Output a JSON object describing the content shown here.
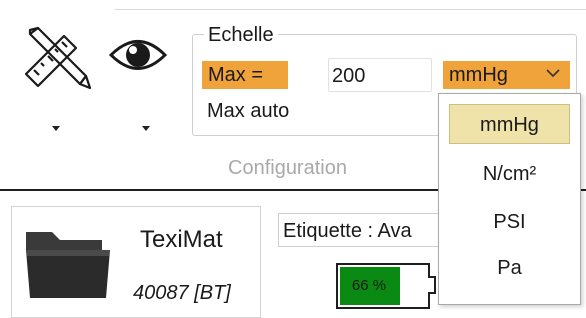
{
  "toolbar": {
    "tools_icon": "pencil-ruler-icon",
    "view_icon": "eye-icon"
  },
  "scale_group": {
    "title": "Echelle",
    "max_label": "Max =",
    "max_value": "200",
    "unit_selected": "mmHg",
    "max_auto_label": "Max auto",
    "section_label": "Configuration",
    "accent_color": "#f0a33b"
  },
  "unit_dropdown": {
    "options": [
      "mmHg",
      "N/cm²",
      "PSI",
      "Pa"
    ],
    "selected": "mmHg"
  },
  "device_card": {
    "name": "TexiMat",
    "id": "40087 [BT]",
    "icon": "folder-icon"
  },
  "label_field": {
    "value": "Etiquette : Ava"
  },
  "battery": {
    "text": "66 %",
    "level": 0.66,
    "color": "#0a8a12"
  }
}
